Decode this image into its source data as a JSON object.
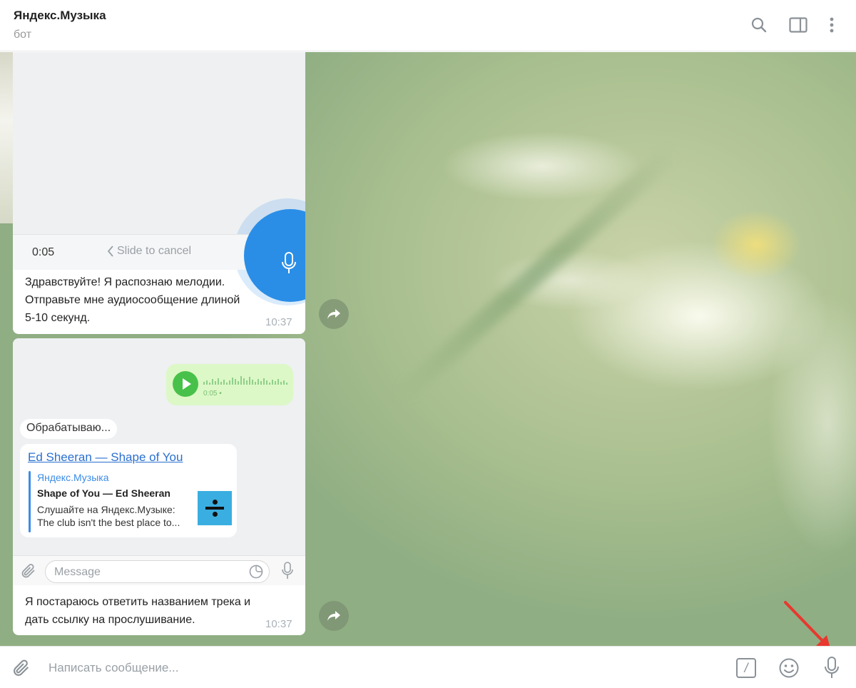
{
  "header": {
    "title": "Яндекс.Музыка",
    "subtitle": "бот",
    "icons": [
      "search-icon",
      "sidebar-toggle-icon",
      "more-vertical-icon"
    ]
  },
  "messages": [
    {
      "type": "image-with-text",
      "screenshot": {
        "recording_time": "0:05",
        "slide_to_cancel": "Slide to cancel"
      },
      "text": [
        "Здравствуйте! Я распознаю мелодии.",
        "Отправьте мне аудиосообщение длиной",
        "5-10 секунд."
      ],
      "time": "10:37"
    },
    {
      "type": "image-with-text",
      "screenshot": {
        "voice_duration": "0:05 •",
        "processing_text": "Обрабатываю...",
        "link_title": "Ed Sheeran — Shape of You",
        "preview_site": "Яндекс.Музыка",
        "preview_title": "Shape of You — Ed Sheeran",
        "preview_desc_1": "Слушайте на Яндекс.Музыке:",
        "preview_desc_2": "The club isn't the best place to...",
        "input_placeholder": "Message"
      },
      "text": [
        "Я постараюсь ответить названием трека и",
        "дать ссылку на прослушивание."
      ],
      "time": "10:37"
    }
  ],
  "composer": {
    "placeholder": "Написать сообщение...",
    "command_label": "/"
  }
}
